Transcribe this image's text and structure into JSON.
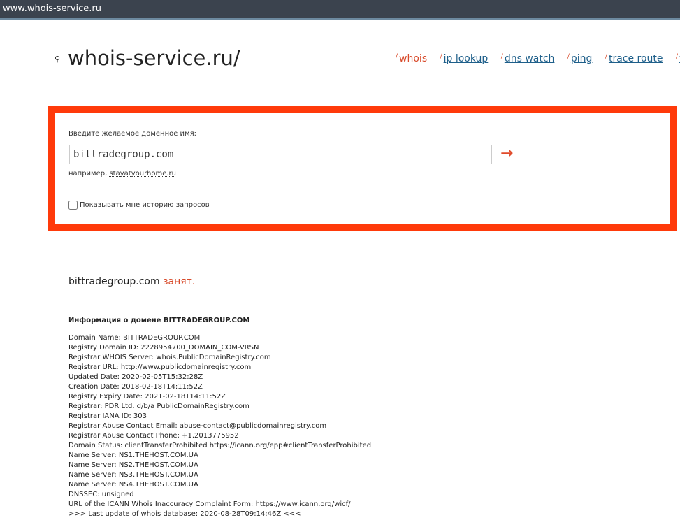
{
  "browser": {
    "url": "www.whois-service.ru"
  },
  "header": {
    "logo": "whois-service.ru/",
    "nav": [
      {
        "label": "whois",
        "active": true
      },
      {
        "label": "ip lookup"
      },
      {
        "label": "dns watch"
      },
      {
        "label": "ping"
      },
      {
        "label": "trace route"
      },
      {
        "label": "v"
      }
    ]
  },
  "form": {
    "label": "Введите желаемое доменное имя:",
    "value": "bittradegroup.com",
    "submit": "→",
    "example_prefix": "например,",
    "example_link": "stayatyourhome.ru",
    "history_label": "Показывать мне историю запросов"
  },
  "result": {
    "domain": "bittradegroup.com",
    "status": "занят.",
    "info_heading": "Информация о домене BITTRADEGROUP.COM",
    "lines": [
      "Domain Name: BITTRADEGROUP.COM",
      "Registry Domain ID: 2228954700_DOMAIN_COM-VRSN",
      "Registrar WHOIS Server: whois.PublicDomainRegistry.com",
      "Registrar URL: http://www.publicdomainregistry.com",
      "Updated Date: 2020-02-05T15:32:28Z",
      "Creation Date: 2018-02-18T14:11:52Z",
      "Registry Expiry Date: 2021-02-18T14:11:52Z",
      "Registrar: PDR Ltd. d/b/a PublicDomainRegistry.com",
      "Registrar IANA ID: 303",
      "Registrar Abuse Contact Email: abuse-contact@publicdomainregistry.com",
      "Registrar Abuse Contact Phone: +1.2013775952",
      "Domain Status: clientTransferProhibited https://icann.org/epp#clientTransferProhibited",
      "Name Server: NS1.THEHOST.COM.UA",
      "Name Server: NS2.THEHOST.COM.UA",
      "Name Server: NS3.THEHOST.COM.UA",
      "Name Server: NS4.THEHOST.COM.UA",
      "DNSSEC: unsigned",
      "URL of the ICANN Whois Inaccuracy Complaint Form: https://www.icann.org/wicf/",
      ">>> Last update of whois database: 2020-08-28T09:14:46Z <<<"
    ]
  }
}
